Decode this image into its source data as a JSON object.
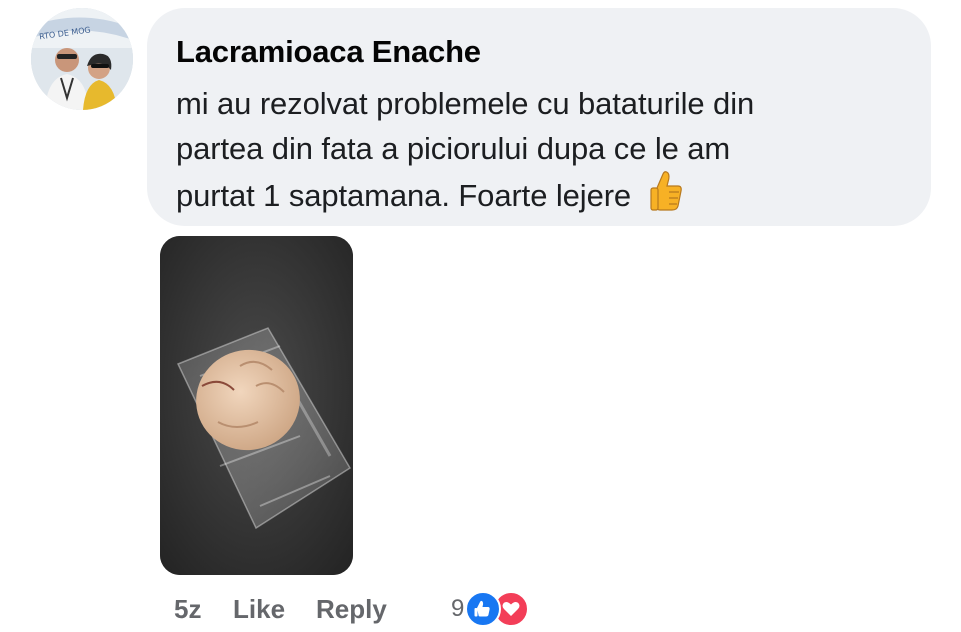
{
  "comment": {
    "author": "Lacramioaca Enache",
    "lines": [
      "mi au rezolvat problemele cu bataturile din",
      "partea din fata a piciorului dupa ce le am",
      "purtat 1 saptamana. Foarte lejere"
    ],
    "emoji": "thumbs-up-icon"
  },
  "avatar": {
    "banner_text": "RTO DE MOG"
  },
  "attachment": {
    "description_icon": "photo-attachment"
  },
  "actions": {
    "time": "5z",
    "like_label": "Like",
    "reply_label": "Reply"
  },
  "reactions": {
    "count": "9",
    "types": [
      "like-reaction-icon",
      "love-reaction-icon"
    ],
    "colors": {
      "like": "#1877f2",
      "love": "#f33e58"
    }
  }
}
